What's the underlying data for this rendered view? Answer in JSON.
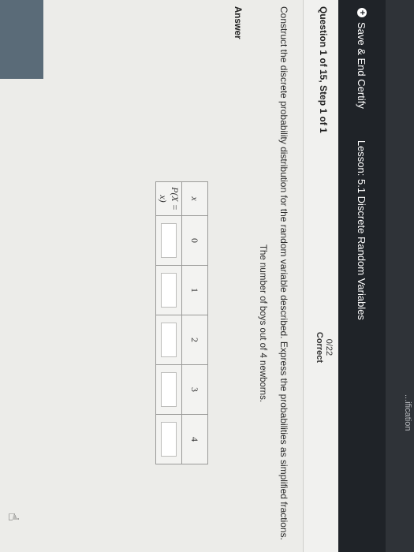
{
  "header": {
    "partial_text": "...ification",
    "save_end_label": "Save & End Certify",
    "lesson_title": "Lesson: 5.1 Discrete Random Variables"
  },
  "question": {
    "label": "Question 1 of 15, Step 1 of 1",
    "score": "0/22",
    "status": "Correct",
    "instruction": "Construct the discrete probability distribution for the random variable described. Express the probabilities as simplified fractions.",
    "description": "The number of boys out of 4 newborns."
  },
  "answer": {
    "label": "Answer",
    "row_headers": [
      "x",
      "P(X = x)"
    ],
    "x_values": [
      "0",
      "1",
      "2",
      "3",
      "4"
    ]
  },
  "icons": {
    "save": "plus-circle-icon",
    "pointer": "hand-pointer-icon"
  }
}
